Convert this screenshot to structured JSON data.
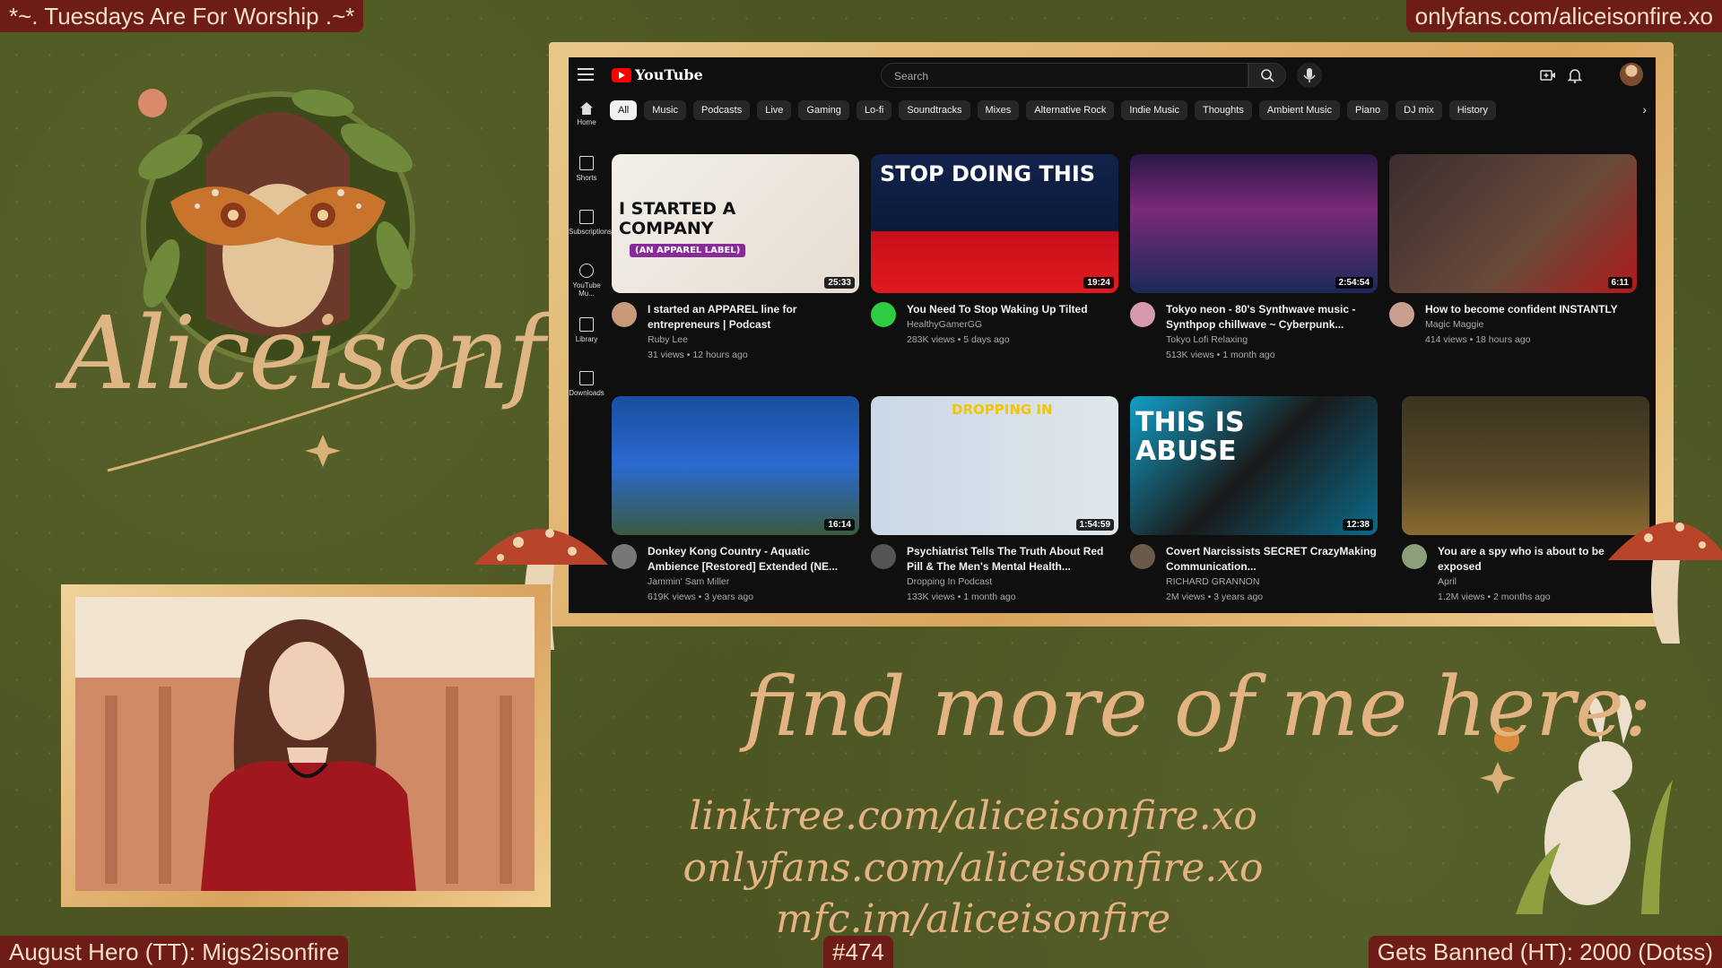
{
  "overlay": {
    "top_left": "*~. Tuesdays Are For Worship .~*",
    "top_right": "onlyfans.com/aliceisonfire.xo",
    "bottom_left": "August Hero (TT): Migs2isonfire",
    "bottom_center": "#474",
    "bottom_right": "Gets Banned (HT): 2000 (Dotss)",
    "brand_name": "Aliceisonfire",
    "find_title": "find more of me here:",
    "links": [
      "linktree.com/aliceisonfire.xo",
      "onlyfans.com/aliceisonfire.xo",
      "mfc.im/aliceisonfire"
    ]
  },
  "youtube": {
    "logo_text": "YouTube",
    "search_placeholder": "Search",
    "sidebar": [
      {
        "label": "Home",
        "icon": "home-icon"
      },
      {
        "label": "Shorts",
        "icon": "shorts-icon"
      },
      {
        "label": "Subscriptions",
        "icon": "subscriptions-icon"
      },
      {
        "label": "YouTube Mu...",
        "icon": "youtube-music-icon"
      },
      {
        "label": "Library",
        "icon": "library-icon"
      },
      {
        "label": "Downloads",
        "icon": "download-icon"
      }
    ],
    "chips": [
      "All",
      "Music",
      "Podcasts",
      "Live",
      "Gaming",
      "Lo-fi",
      "Soundtracks",
      "Mixes",
      "Alternative Rock",
      "Indie Music",
      "Thoughts",
      "Ambient Music",
      "Piano",
      "DJ mix",
      "History"
    ],
    "videos": [
      {
        "title": "I started an APPAREL line for entrepreneurs | Podcast",
        "channel": "Ruby Lee",
        "stats": "31 views • 12 hours ago",
        "duration": "25:33",
        "thumb_text": "I STARTED A COMPANY",
        "thumb_sub": "(AN APPAREL LABEL)"
      },
      {
        "title": "You Need To Stop Waking Up Tilted",
        "channel": "HealthyGamerGG",
        "stats": "283K views • 5 days ago",
        "duration": "19:24",
        "thumb_text": "STOP DOING THIS",
        "thumb_sub": ""
      },
      {
        "title": "Tokyo neon - 80's Synthwave music - Synthpop chillwave ~ Cyberpunk...",
        "channel": "Tokyo Lofi Relaxing",
        "stats": "513K views • 1 month ago",
        "duration": "2:54:54",
        "thumb_text": "",
        "thumb_sub": ""
      },
      {
        "title": "How to become confident INSTANTLY",
        "channel": "Magic Maggie",
        "stats": "414 views • 18 hours ago",
        "duration": "6:11",
        "thumb_text": "",
        "thumb_sub": ""
      },
      {
        "title": "Donkey Kong Country - Aquatic Ambience [Restored] Extended (NE...",
        "channel": "Jammin' Sam Miller",
        "stats": "619K views • 3 years ago",
        "duration": "16:14",
        "thumb_text": "",
        "thumb_sub": ""
      },
      {
        "title": "Psychiatrist Tells The Truth About Red Pill & The Men's Mental Health...",
        "channel": "Dropping In Podcast",
        "stats": "133K views • 1 month ago",
        "duration": "1:54:59",
        "thumb_text": "DROPPING IN",
        "thumb_sub": ""
      },
      {
        "title": "Covert Narcissists SECRET CrazyMaking Communication...",
        "channel": "RICHARD GRANNON",
        "stats": "2M views • 3 years ago",
        "duration": "12:38",
        "thumb_text": "THIS IS ABUSE",
        "thumb_sub": ""
      },
      {
        "title": "You are a spy who is about to be exposed",
        "channel": "April",
        "stats": "1.2M views • 2 months ago",
        "duration": "",
        "thumb_text": "",
        "thumb_sub": ""
      }
    ]
  }
}
